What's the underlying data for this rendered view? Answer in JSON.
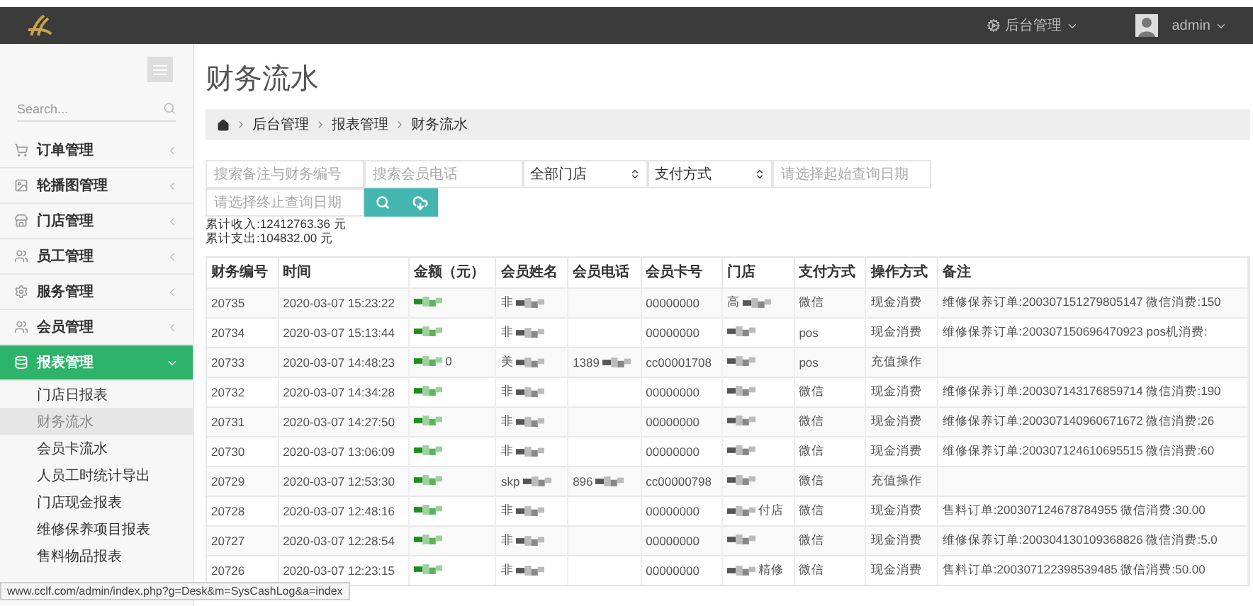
{
  "topbar": {
    "menu_label": "后台管理",
    "user": "admin"
  },
  "sidebar": {
    "search_placeholder": "Search...",
    "items": [
      {
        "label": "订单管理",
        "expanded": false,
        "selected": false
      },
      {
        "label": "轮播图管理",
        "expanded": false,
        "selected": false
      },
      {
        "label": "门店管理",
        "expanded": false,
        "selected": false
      },
      {
        "label": "员工管理",
        "expanded": false,
        "selected": false
      },
      {
        "label": "服务管理",
        "expanded": false,
        "selected": false
      },
      {
        "label": "会员管理",
        "expanded": false,
        "selected": false
      },
      {
        "label": "报表管理",
        "expanded": true,
        "selected": true,
        "children": [
          {
            "label": "门店日报表",
            "selected": false
          },
          {
            "label": "财务流水",
            "selected": true
          },
          {
            "label": "会员卡流水",
            "selected": false
          },
          {
            "label": "人员工时统计导出",
            "selected": false
          },
          {
            "label": "门店现金报表",
            "selected": false
          },
          {
            "label": "维修保养项目报表",
            "selected": false
          },
          {
            "label": "售料物品报表",
            "selected": false
          }
        ]
      }
    ]
  },
  "page_title": "财务流水",
  "breadcrumb": [
    "后台管理",
    "报表管理",
    "财务流水"
  ],
  "filters": [
    {
      "kind": "input",
      "placeholder": "搜索备注与财务编号"
    },
    {
      "kind": "input",
      "placeholder": "搜索会员电话"
    },
    {
      "kind": "select",
      "value": "全部门店"
    },
    {
      "kind": "select",
      "value": "支付方式"
    },
    {
      "kind": "input",
      "placeholder": "请选择起始查询日期"
    },
    {
      "kind": "input",
      "placeholder": "请选择终止查询日期"
    }
  ],
  "totals": [
    "累计收入:12412763.36 元",
    "累计支出:104832.00 元"
  ],
  "table": {
    "columns": [
      "财务编号",
      "时间",
      "金额（元）",
      "会员姓名",
      "会员电话",
      "会员卡号",
      "门店",
      "支付方式",
      "操作方式",
      "备注"
    ],
    "rows": [
      {
        "id": "20735",
        "time": "2020-03-07 15:23:22",
        "amount": {
          "blur_before": true
        },
        "name": {
          "text": "非",
          "blur_after": true
        },
        "card": "00000000",
        "store": {
          "text": "高",
          "blur_after": true
        },
        "pay": "微信",
        "op": "现金消费",
        "note": "维修保养订单:200307151279805147 微信消费:150"
      },
      {
        "id": "20734",
        "time": "2020-03-07 15:13:44",
        "amount": {
          "blur_before": true
        },
        "name": {
          "text": "非",
          "blur_after": true
        },
        "card": "00000000",
        "store": {
          "blur_before": true
        },
        "pay": "pos",
        "op": "现金消费",
        "note": "维修保养订单:200307150696470923 pos机消费:"
      },
      {
        "id": "20733",
        "time": "2020-03-07 14:48:23",
        "amount": {
          "text": "0",
          "blur_before": true
        },
        "name": {
          "text": "美",
          "blur_after": true
        },
        "phone": {
          "text": "1389",
          "blur_after": true
        },
        "card": "cc00001708",
        "store": {
          "blur_before": true
        },
        "pay": "pos",
        "op": "充值操作"
      },
      {
        "id": "20732",
        "time": "2020-03-07 14:34:28",
        "amount": {
          "blur_before": true
        },
        "name": {
          "text": "非",
          "blur_after": true
        },
        "card": "00000000",
        "store": {
          "blur_before": true
        },
        "pay": "微信",
        "op": "现金消费",
        "note": "维修保养订单:200307143176859714 微信消费:190"
      },
      {
        "id": "20731",
        "time": "2020-03-07 14:27:50",
        "amount": {
          "blur_before": true
        },
        "name": {
          "text": "非",
          "blur_after": true
        },
        "card": "00000000",
        "store": {
          "blur_before": true
        },
        "pay": "微信",
        "op": "现金消费",
        "note": "维修保养订单:200307140960671672 微信消费:26"
      },
      {
        "id": "20730",
        "time": "2020-03-07 13:06:09",
        "amount": {
          "blur_before": true
        },
        "name": {
          "text": "非",
          "blur_after": true
        },
        "card": "00000000",
        "store": {
          "blur_before": true
        },
        "pay": "微信",
        "op": "现金消费",
        "note": "维修保养订单:200307124610695515 微信消费:60"
      },
      {
        "id": "20729",
        "time": "2020-03-07 12:53:30",
        "amount": {
          "blur_before": true
        },
        "name": {
          "text": "skp",
          "blur_after": true
        },
        "phone": {
          "text": "896",
          "blur_after": true
        },
        "card": "cc00000798",
        "store": {
          "blur_before": true
        },
        "pay": "微信",
        "op": "充值操作"
      },
      {
        "id": "20728",
        "time": "2020-03-07 12:48:16",
        "amount": {
          "blur_before": true
        },
        "name": {
          "text": "非",
          "blur_after": true
        },
        "card": "00000000",
        "store": {
          "text": "付店",
          "blur_before": true
        },
        "pay": "微信",
        "op": "现金消费",
        "note": "售料订单:200307124678784955 微信消费:30.00"
      },
      {
        "id": "20727",
        "time": "2020-03-07 12:28:54",
        "amount": {
          "blur_before": true
        },
        "name": {
          "text": "非",
          "blur_after": true
        },
        "card": "00000000",
        "store": {
          "blur_before": true
        },
        "pay": "微信",
        "op": "现金消费",
        "note": "维修保养订单:200304130109368826 微信消费:5.0"
      },
      {
        "id": "20726",
        "time": "2020-03-07 12:23:15",
        "amount": {
          "blur_before": true
        },
        "name": {
          "text": "非",
          "blur_after": true
        },
        "card": "00000000",
        "store": {
          "text": "精修",
          "blur_before": true
        },
        "pay": "微信",
        "op": "现金消费",
        "note": "售料订单:200307122398539485 微信消费:50.00"
      }
    ]
  },
  "status_bar": "www.cclf.com/admin/index.php?g=Desk&m=SysCashLog&a=index"
}
